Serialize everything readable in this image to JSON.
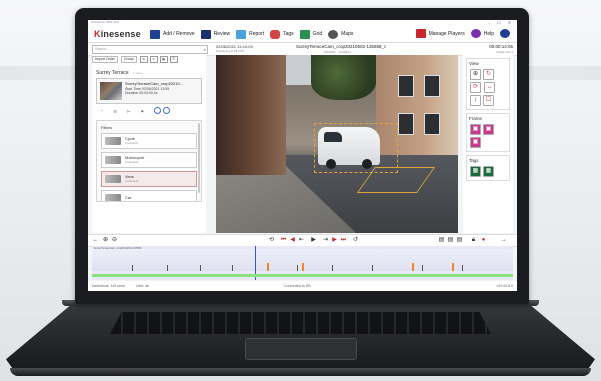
{
  "window": {
    "title": "Kinesense VMS v2.0"
  },
  "app": {
    "logo_prefix": "K",
    "logo_suffix": "inesense"
  },
  "nav": {
    "add_remove": "Add / Remove",
    "review": "Review",
    "report": "Report",
    "tags": "Tags",
    "grid": "Grid",
    "maps": "Maps",
    "manage_players": "Manage Players",
    "help": "Help"
  },
  "search": {
    "placeholder": "Search..."
  },
  "video_info": {
    "datetime": "02/06/2021 14:10:03",
    "datetime_sub": "Displaying at 25 FPS",
    "clip_name": "SurreyTerraceCam_crop20210602-135558_c",
    "size_info": "23Mb/8s · 10.3Mbps",
    "timecode": "00:00:14:05",
    "timecode_sub": "bitrate info 1"
  },
  "sidebar": {
    "import_order": "Import Order",
    "group": "Group",
    "location": "Surrey Terrace",
    "location_hint": "1 video",
    "clip": {
      "name": "SurreyTerraceCam_crop20210...",
      "start": "Start Time  02/06/2021 13:55",
      "duration": "Duration  00:03:40.0s"
    },
    "filters_header": "Filters",
    "filters": [
      {
        "name": "Cycle",
        "sub": "(Included)"
      },
      {
        "name": "Motorcycle",
        "sub": "(Included)"
      },
      {
        "name": "Vans",
        "sub": "(Included)"
      },
      {
        "name": "Car",
        "sub": ""
      }
    ]
  },
  "right_panel": {
    "view_header": "View",
    "frame_header": "Frame",
    "tags_header": "Tags"
  },
  "timeline": {
    "label": "SurreyTerraceCam_crop20210602-135558",
    "marker_text": "SurreyTerraceCam_crop20210602-135558_c.mp4"
  },
  "statusbar": {
    "left": "Detections: 145 seen",
    "user": "User: ab",
    "center": "Connected to DB",
    "right": "v20.00.8.0"
  },
  "colors": {
    "accent_red": "#c8282b",
    "zone_orange": "#e2a43a",
    "timeline_green": "#8be083",
    "timeline_marker": "#e78a2a"
  }
}
